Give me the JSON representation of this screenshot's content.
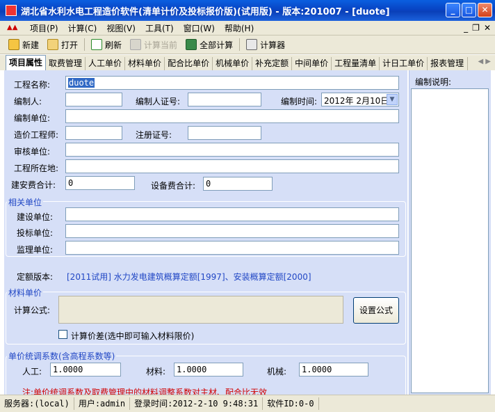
{
  "window": {
    "title": "湖北省水利水电工程造价软件(清单计价及投标报价版)(试用版) - 版本:201007 - [duote]",
    "minimize": "_",
    "maximize": "□",
    "close": "✕"
  },
  "menu": {
    "items": [
      "项目(P)",
      "计算(C)",
      "视图(V)",
      "工具(T)",
      "窗口(W)",
      "帮助(H)"
    ],
    "mdi": [
      "_",
      "❐",
      "✕"
    ]
  },
  "toolbar": {
    "new": "新建",
    "open": "打开",
    "refresh": "刷新",
    "calc_current": "计算当前",
    "calc_all": "全部计算",
    "calculator": "计算器"
  },
  "tabs": [
    "项目属性",
    "取费管理",
    "人工单价",
    "材料单价",
    "配合比单价",
    "机械单价",
    "补充定额",
    "中间单价",
    "工程量清单",
    "计日工单价",
    "报表管理"
  ],
  "form": {
    "project_name_label": "工程名称:",
    "project_name_value": "duote",
    "compiler_label": "编制人:",
    "compiler_cert_label": "编制人证号:",
    "compile_time_label": "编制时间:",
    "compile_time_value": "2012年 2月10日",
    "compile_unit_label": "编制单位:",
    "cost_engineer_label": "造价工程师:",
    "reg_cert_label": "注册证号:",
    "audit_unit_label": "审核单位:",
    "location_label": "工程所在地:",
    "build_total_label": "建安费合计:",
    "build_total_value": "0",
    "equip_total_label": "设备费合计:",
    "equip_total_value": "0"
  },
  "related": {
    "title": "相关单位",
    "construction_label": "建设单位:",
    "bidding_label": "投标单位:",
    "supervision_label": "监理单位:"
  },
  "quota": {
    "label": "定额版本:",
    "value": "[2011试用] 水力发电建筑概算定额[1997]、安装概算定额[2000]"
  },
  "material": {
    "title": "材料单价",
    "formula_label": "计算公式:",
    "set_formula": "设置公式",
    "price_diff": "计算价差(选中即可输入材料限价)"
  },
  "coeff": {
    "title": "单价统调系数(含高程系数等)",
    "labor_label": "人工:",
    "labor_value": "1.0000",
    "material_label": "材料:",
    "material_value": "1.0000",
    "machine_label": "机械:",
    "machine_value": "1.0000",
    "note": "注:单价统调系数及取费管理中的材料调整系数对主材、配合比无效"
  },
  "side": {
    "desc_label": "编制说明:"
  },
  "status": {
    "server": "服务器:(local)",
    "user": "用户:admin",
    "login": "登录时间:2012-2-10 9:48:31",
    "software_id": "软件ID:0-0"
  }
}
